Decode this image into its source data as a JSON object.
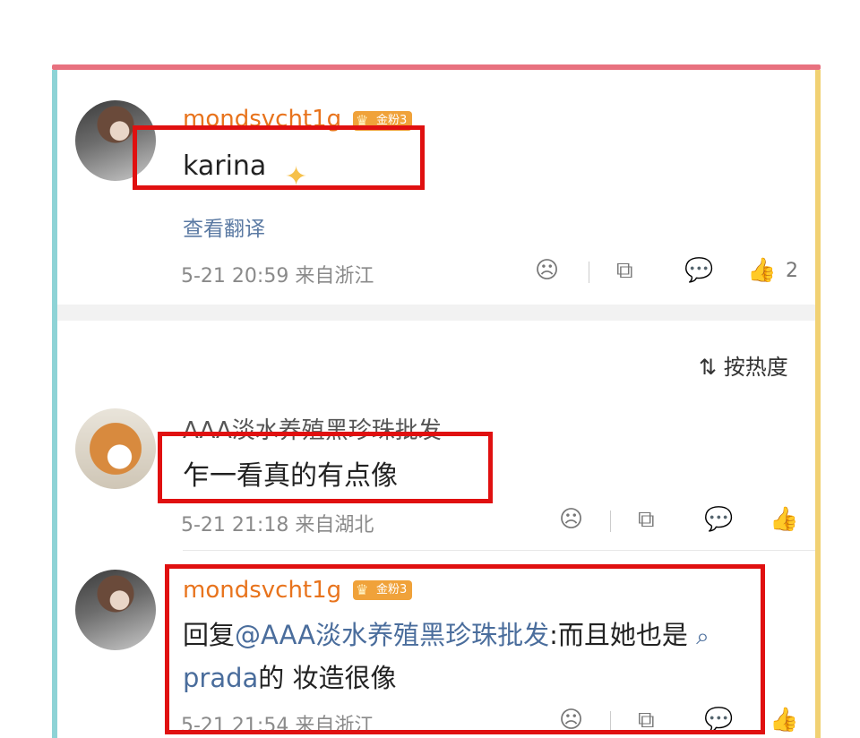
{
  "comments": [
    {
      "username": "mondsvcht1g",
      "badge": "金粉3",
      "text": "karina",
      "translate": "查看翻译",
      "meta": "5-21 20:59  来自浙江",
      "like_count": "2"
    },
    {
      "username": "AAA淡水养殖黑珍珠批发",
      "text": "乍一看真的有点像",
      "meta": "5-21 21:18  来自湖北"
    },
    {
      "username": "mondsvcht1g",
      "badge": "金粉3",
      "reply_prefix": "回复",
      "reply_mention": "@AAA淡水养殖黑珍珠批发",
      "reply_text": ":而且她也是",
      "reply_link": "prada",
      "reply_tail": "的 妆造很像",
      "meta": "5-21 21:54  来自浙江"
    }
  ],
  "sort": {
    "label": "按热度"
  },
  "icons": {
    "dislike": "☹",
    "share": "⧉",
    "comment": "💬",
    "like": "👍",
    "sort": "⇅",
    "search": "⌕"
  },
  "colors": {
    "username": "#e8731c",
    "link": "#4a6d9c",
    "annotation": "#e01010"
  }
}
